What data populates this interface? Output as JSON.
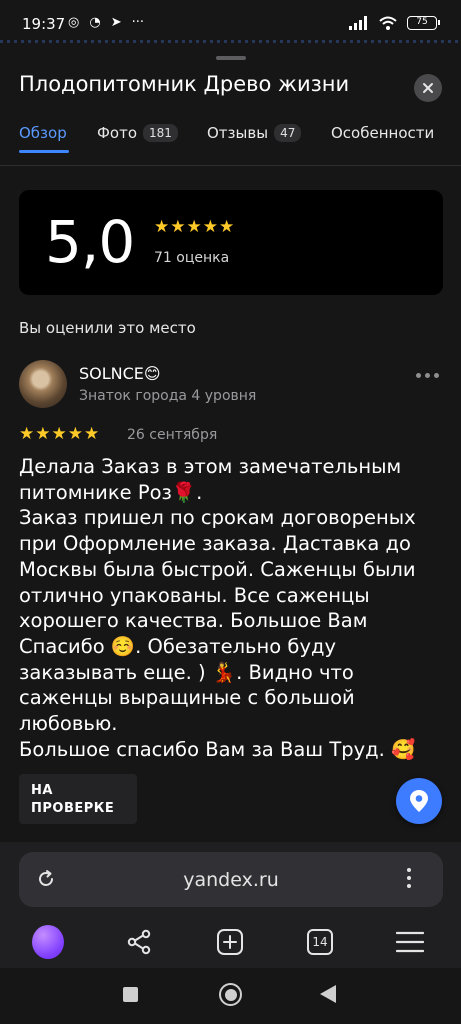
{
  "status": {
    "time": "19:37",
    "battery": "75"
  },
  "header": {
    "title": "Плодопитомник Древо жизни"
  },
  "tabs": [
    {
      "label": "Обзор",
      "count": ""
    },
    {
      "label": "Фото",
      "count": "181"
    },
    {
      "label": "Отзывы",
      "count": "47"
    },
    {
      "label": "Особенности",
      "count": ""
    }
  ],
  "rating": {
    "value": "5,0",
    "stars": 5,
    "count_label": "71 оценка"
  },
  "section": {
    "you_rated": "Вы оценили это место"
  },
  "review": {
    "author": "SOLNCE😊",
    "author_level": "Знаток города 4 уровня",
    "stars": 5,
    "date": "26 сентября",
    "text": "Делала Заказ в этом замечательным питомнике Роз🌹.\nЗаказ пришел по срокам договореных при Оформление заказа. Даставка до Москвы была быстрой. Саженцы были отлично упакованы. Все саженцы хорошего качества. Большое Вам Спасибо ☺️. Обезательно буду заказывать еще. ) 💃. Видно что саженцы выращиные с большой любовью.\nБольшое спасибо Вам за Ваш Труд. 🥰",
    "status_badge": "НА\nПРОВЕРКЕ"
  },
  "browser": {
    "url": "yandex.ru",
    "tabs_count": "14"
  },
  "colors": {
    "accent": "#3d86ff",
    "star": "#ffca28",
    "background": "#161617",
    "card": "#000000"
  },
  "icons": [
    "wifi-icon",
    "signal-icon",
    "close-icon",
    "more-icon",
    "map-pin-icon",
    "reload-icon",
    "share-icon",
    "plus-icon",
    "menu-icon"
  ]
}
